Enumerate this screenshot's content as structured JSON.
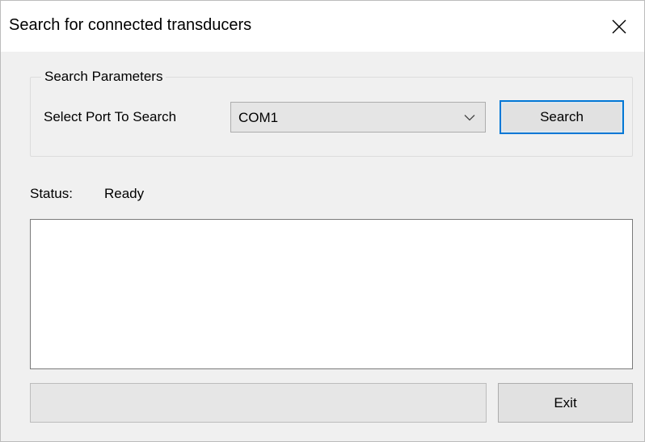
{
  "window": {
    "title": "Search for connected transducers",
    "close_icon": "close-icon"
  },
  "search_parameters": {
    "group_label": "Search Parameters",
    "port_label": "Select Port To Search",
    "port_selected": "COM1",
    "dropdown_icon": "chevron-down-icon",
    "search_button_label": "Search"
  },
  "status": {
    "label": "Status:",
    "value": "Ready"
  },
  "results": {
    "items": []
  },
  "progress": {
    "value": 0
  },
  "footer": {
    "exit_button_label": "Exit"
  },
  "colors": {
    "window_bg": "#f0f0f0",
    "focus_border": "#0078d7",
    "button_bg": "#e1e1e1",
    "list_bg": "#ffffff"
  }
}
